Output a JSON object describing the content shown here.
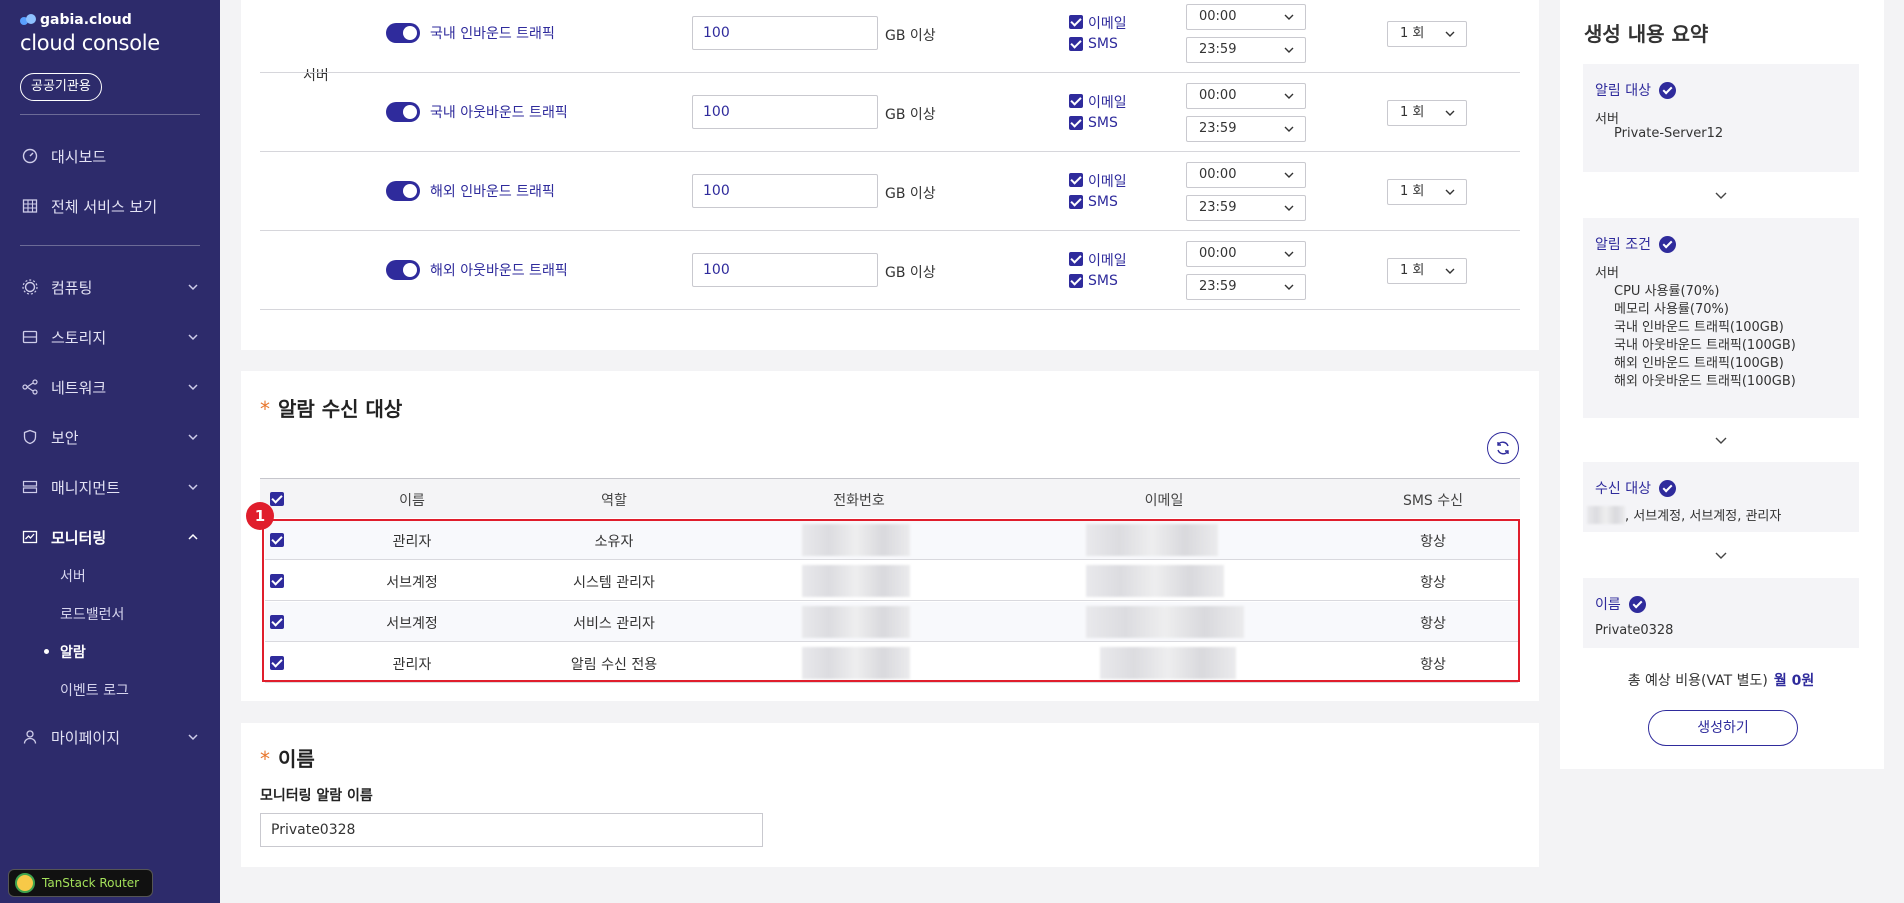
{
  "sidebar": {
    "brand": "gabia.cloud",
    "console_title": "cloud console",
    "badge": "공공기관용",
    "nav": {
      "dashboard": "대시보드",
      "all_services": "전체 서비스 보기",
      "computing": "컴퓨팅",
      "storage": "스토리지",
      "network": "네트워크",
      "security": "보안",
      "management": "매니지먼트",
      "monitoring": "모니터링",
      "mypage": "마이페이지"
    },
    "monitoring_sub": {
      "server": "서버",
      "loadbalancer": "로드밸런서",
      "alarm": "알람",
      "event_log": "이벤트 로그"
    },
    "devtool": "TanStack Router"
  },
  "conditions": {
    "group_label": "서버",
    "unit": "GB 이상",
    "email_label": "이메일",
    "sms_label": "SMS",
    "rows": [
      {
        "name": "국내 인바운드 트래픽",
        "value": "100",
        "start": "00:00",
        "end": "23:59",
        "count": "1 회"
      },
      {
        "name": "국내 아웃바운드 트래픽",
        "value": "100",
        "start": "00:00",
        "end": "23:59",
        "count": "1 회"
      },
      {
        "name": "해외 인바운드 트래픽",
        "value": "100",
        "start": "00:00",
        "end": "23:59",
        "count": "1 회"
      },
      {
        "name": "해외 아웃바운드 트래픽",
        "value": "100",
        "start": "00:00",
        "end": "23:59",
        "count": "1 회"
      }
    ]
  },
  "recipients": {
    "title": "알람 수신 대상",
    "columns": {
      "name": "이름",
      "role": "역할",
      "phone": "전화번호",
      "email": "이메일",
      "sms": "SMS 수신"
    },
    "rows": [
      {
        "name": "관리자",
        "role": "소유자",
        "sms": "항상"
      },
      {
        "name": "서브계정",
        "role": "시스템 관리자",
        "sms": "항상"
      },
      {
        "name": "서브계정",
        "role": "서비스 관리자",
        "sms": "항상"
      },
      {
        "name": "관리자",
        "role": "알림 수신 전용",
        "sms": "항상"
      }
    ],
    "marker": "1"
  },
  "name_section": {
    "title": "이름",
    "field_label": "모니터링 알람 이름",
    "value": "Private0328"
  },
  "summary": {
    "title": "생성 내용 요약",
    "target_head": "알림 대상",
    "target_group": "서버",
    "target_item": "Private-Server12",
    "cond_head": "알림 조건",
    "cond_group": "서버",
    "cond_items": [
      "CPU 사용률(70%)",
      "메모리 사용률(70%)",
      "국내 인바운드 트래픽(100GB)",
      "국내 아웃바운드 트래픽(100GB)",
      "해외 인바운드 트래픽(100GB)",
      "해외 아웃바운드 트래픽(100GB)"
    ],
    "recv_head": "수신 대상",
    "recv_text": ", 서브계정, 서브계정, 관리자",
    "name_head": "이름",
    "name_value": "Private0328",
    "cost_label": "총 예상 비용(VAT 별도)",
    "cost_value": "월 0원",
    "create_button": "생성하기"
  },
  "colors": {
    "sidebar": "#2d2b6b",
    "accent": "#2f2b9c",
    "highlight": "#e01e2c",
    "required": "#e8772e"
  }
}
